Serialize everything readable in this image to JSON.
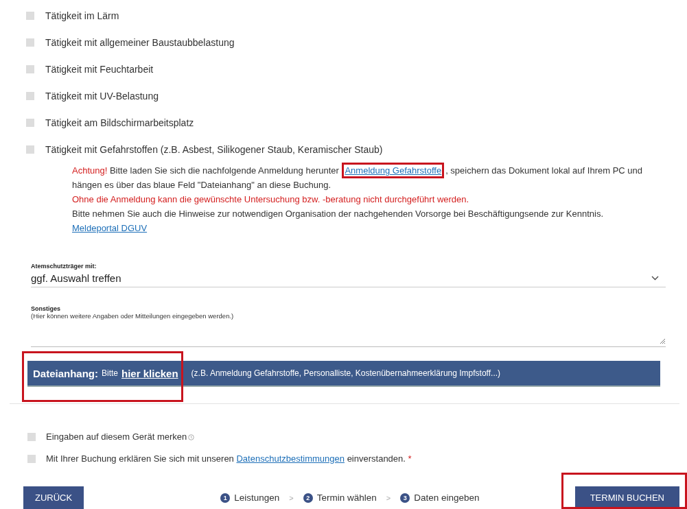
{
  "activities": [
    {
      "label": "Tätigkeit im Lärm",
      "checked": false
    },
    {
      "label": "Tätigkeit mit allgemeiner Baustaubbelastung",
      "checked": false
    },
    {
      "label": "Tätigkeit mit Feuchtarbeit",
      "checked": false
    },
    {
      "label": "Tätigkeit mit UV-Belastung",
      "checked": false
    },
    {
      "label": "Tätigkeit am Bildschirmarbeitsplatz",
      "checked": false
    },
    {
      "label": "Tätigkeit mit Gefahrstoffen (z.B. Asbest, Silikogener Staub, Keramischer Staub)",
      "checked": false
    }
  ],
  "notice": {
    "warning_label": "Achtung!",
    "text_before": "Bitte laden Sie sich die nachfolgende Anmeldung herunter",
    "link": "Anmeldung Gefahrstoffe",
    "text_after": ", speichern das Dokument lokal auf Ihrem PC und hängen es über das blaue Feld \"Dateianhang\" an diese Buchung.",
    "warning_line": "Ohne die Anmeldung kann die gewünschte Untersuchung bzw. -beratung nicht durchgeführt werden.",
    "hint_text": "Bitte nehmen Sie auch die Hinweise zur notwendigen Organisation der nachgehenden Vorsorge bei Beschäftigungsende zur Kenntnis.",
    "hint_link": "Meldeportal DGUV"
  },
  "respirator": {
    "label": "Atemschutzträger mit:",
    "value": "ggf. Auswahl treffen"
  },
  "other": {
    "label": "Sonstiges",
    "hint": "(Hier können weitere Angaben oder Mitteilungen eingegeben werden.)"
  },
  "attachment": {
    "title": "Dateianhang:",
    "text_before": "Bitte",
    "link": "hier klicken",
    "text_after": "(z.B. Anmeldung Gefahrstoffe, Personalliste, Kostenübernahmeerklärung Impfstoff...)"
  },
  "consents": [
    {
      "kind": "remember",
      "text_before": "Eingaben auf diesem Gerät merken",
      "checked": false
    },
    {
      "kind": "privacy",
      "text_before": "Mit Ihrer Buchung erklären Sie sich mit unseren",
      "link": "Datenschutzbestimmungen",
      "text_after": "einverstanden.",
      "required_mark": "*",
      "checked": false
    }
  ],
  "footer": {
    "back_button": "ZURÜCK",
    "steps": [
      {
        "number": "1",
        "label": "Leistungen"
      },
      {
        "number": "2",
        "label": "Termin wählen"
      },
      {
        "number": "3",
        "label": "Daten eingeben"
      }
    ],
    "separator": ">",
    "submit_button": "TERMIN BUCHEN"
  }
}
